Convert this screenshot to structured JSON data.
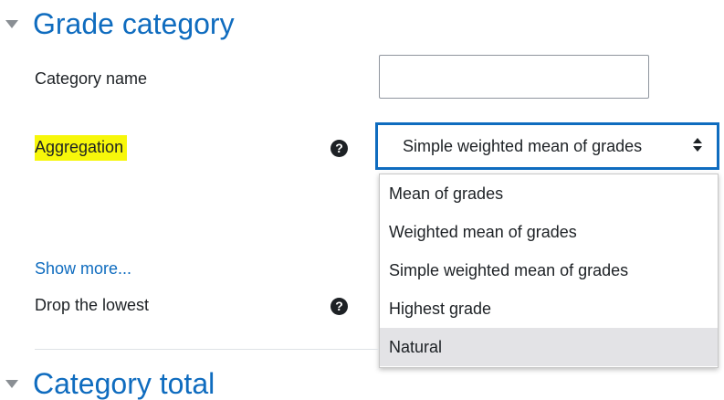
{
  "grade_category": {
    "title": "Grade category",
    "category_name_label": "Category name",
    "category_name_value": "",
    "aggregation_label": "Aggregation",
    "aggregation_selected": "Simple weighted mean of grades",
    "aggregation_options": [
      "Mean of grades",
      "Weighted mean of grades",
      "Simple weighted mean of grades",
      "Highest grade",
      "Natural"
    ],
    "highlighted_option": "Natural",
    "show_more_label": "Show more...",
    "drop_lowest_label": "Drop the lowest",
    "help_icon_glyph": "?"
  },
  "category_total": {
    "title": "Category total"
  },
  "colors": {
    "accent": "#0f6cbf",
    "highlight": "#f7f70a",
    "option_hover": "#e3e3e6",
    "text": "#1d2125"
  },
  "icons": {
    "section_toggle": "caret-down-icon",
    "help": "question-circle-icon",
    "select_arrows": "sort-arrows-icon"
  }
}
